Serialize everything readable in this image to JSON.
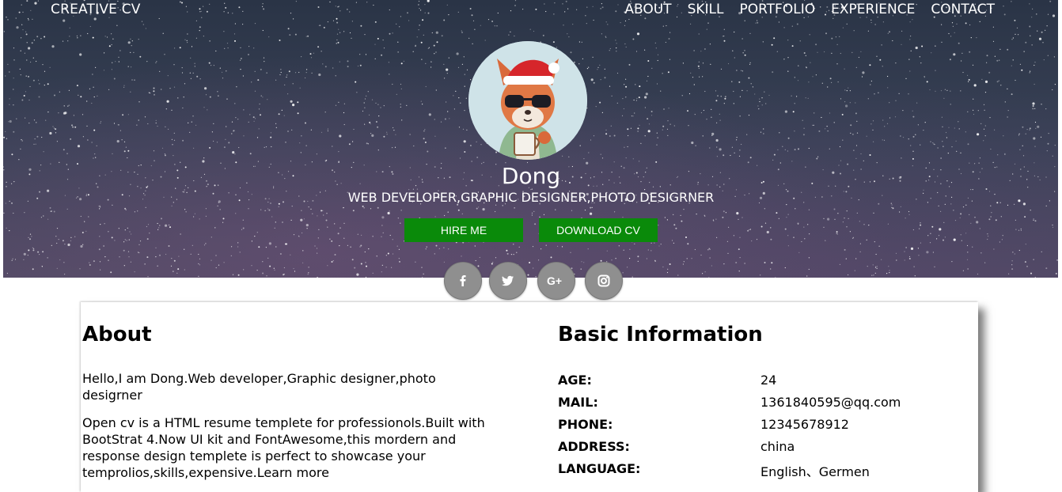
{
  "header": {
    "brand": "CREATIVE CV",
    "nav": [
      "ABOUT",
      "SKILL",
      "PORTFOLIO",
      "EXPERIENCE",
      "CONTACT"
    ]
  },
  "profile": {
    "name": "Dong",
    "title": "WEB DEVELOPER,GRAPHIC DESIGNER,PHOTO DESIGRNER",
    "hire_label": "HIRE ME",
    "download_label": "DOWNLOAD CV",
    "social_icons": [
      "facebook-icon",
      "twitter-icon",
      "google-plus-icon",
      "instagram-icon"
    ]
  },
  "about": {
    "heading": "About",
    "paragraphs": [
      "Hello,I am Dong.Web developer,Graphic designer,photo desigrner",
      "Open cv is a HTML resume templete for professionols.Built with BootStrat 4.Now UI kit and FontAwesome,this mordern and response design templete is perfect to showcase your temprolios,skills,expensive.Learn more"
    ]
  },
  "basic_info": {
    "heading": "Basic Information",
    "rows": [
      {
        "label": "AGE:",
        "value": "24"
      },
      {
        "label": "MAIL:",
        "value": "1361840595@qq.com"
      },
      {
        "label": "PHONE:",
        "value": "12345678912"
      },
      {
        "label": "ADDRESS:",
        "value": "china"
      },
      {
        "label": "LANGUAGE:",
        "value": "English、Germen"
      }
    ]
  },
  "colors": {
    "button_green": "#0a8a0a",
    "social_gray": "#8f8f8f"
  }
}
